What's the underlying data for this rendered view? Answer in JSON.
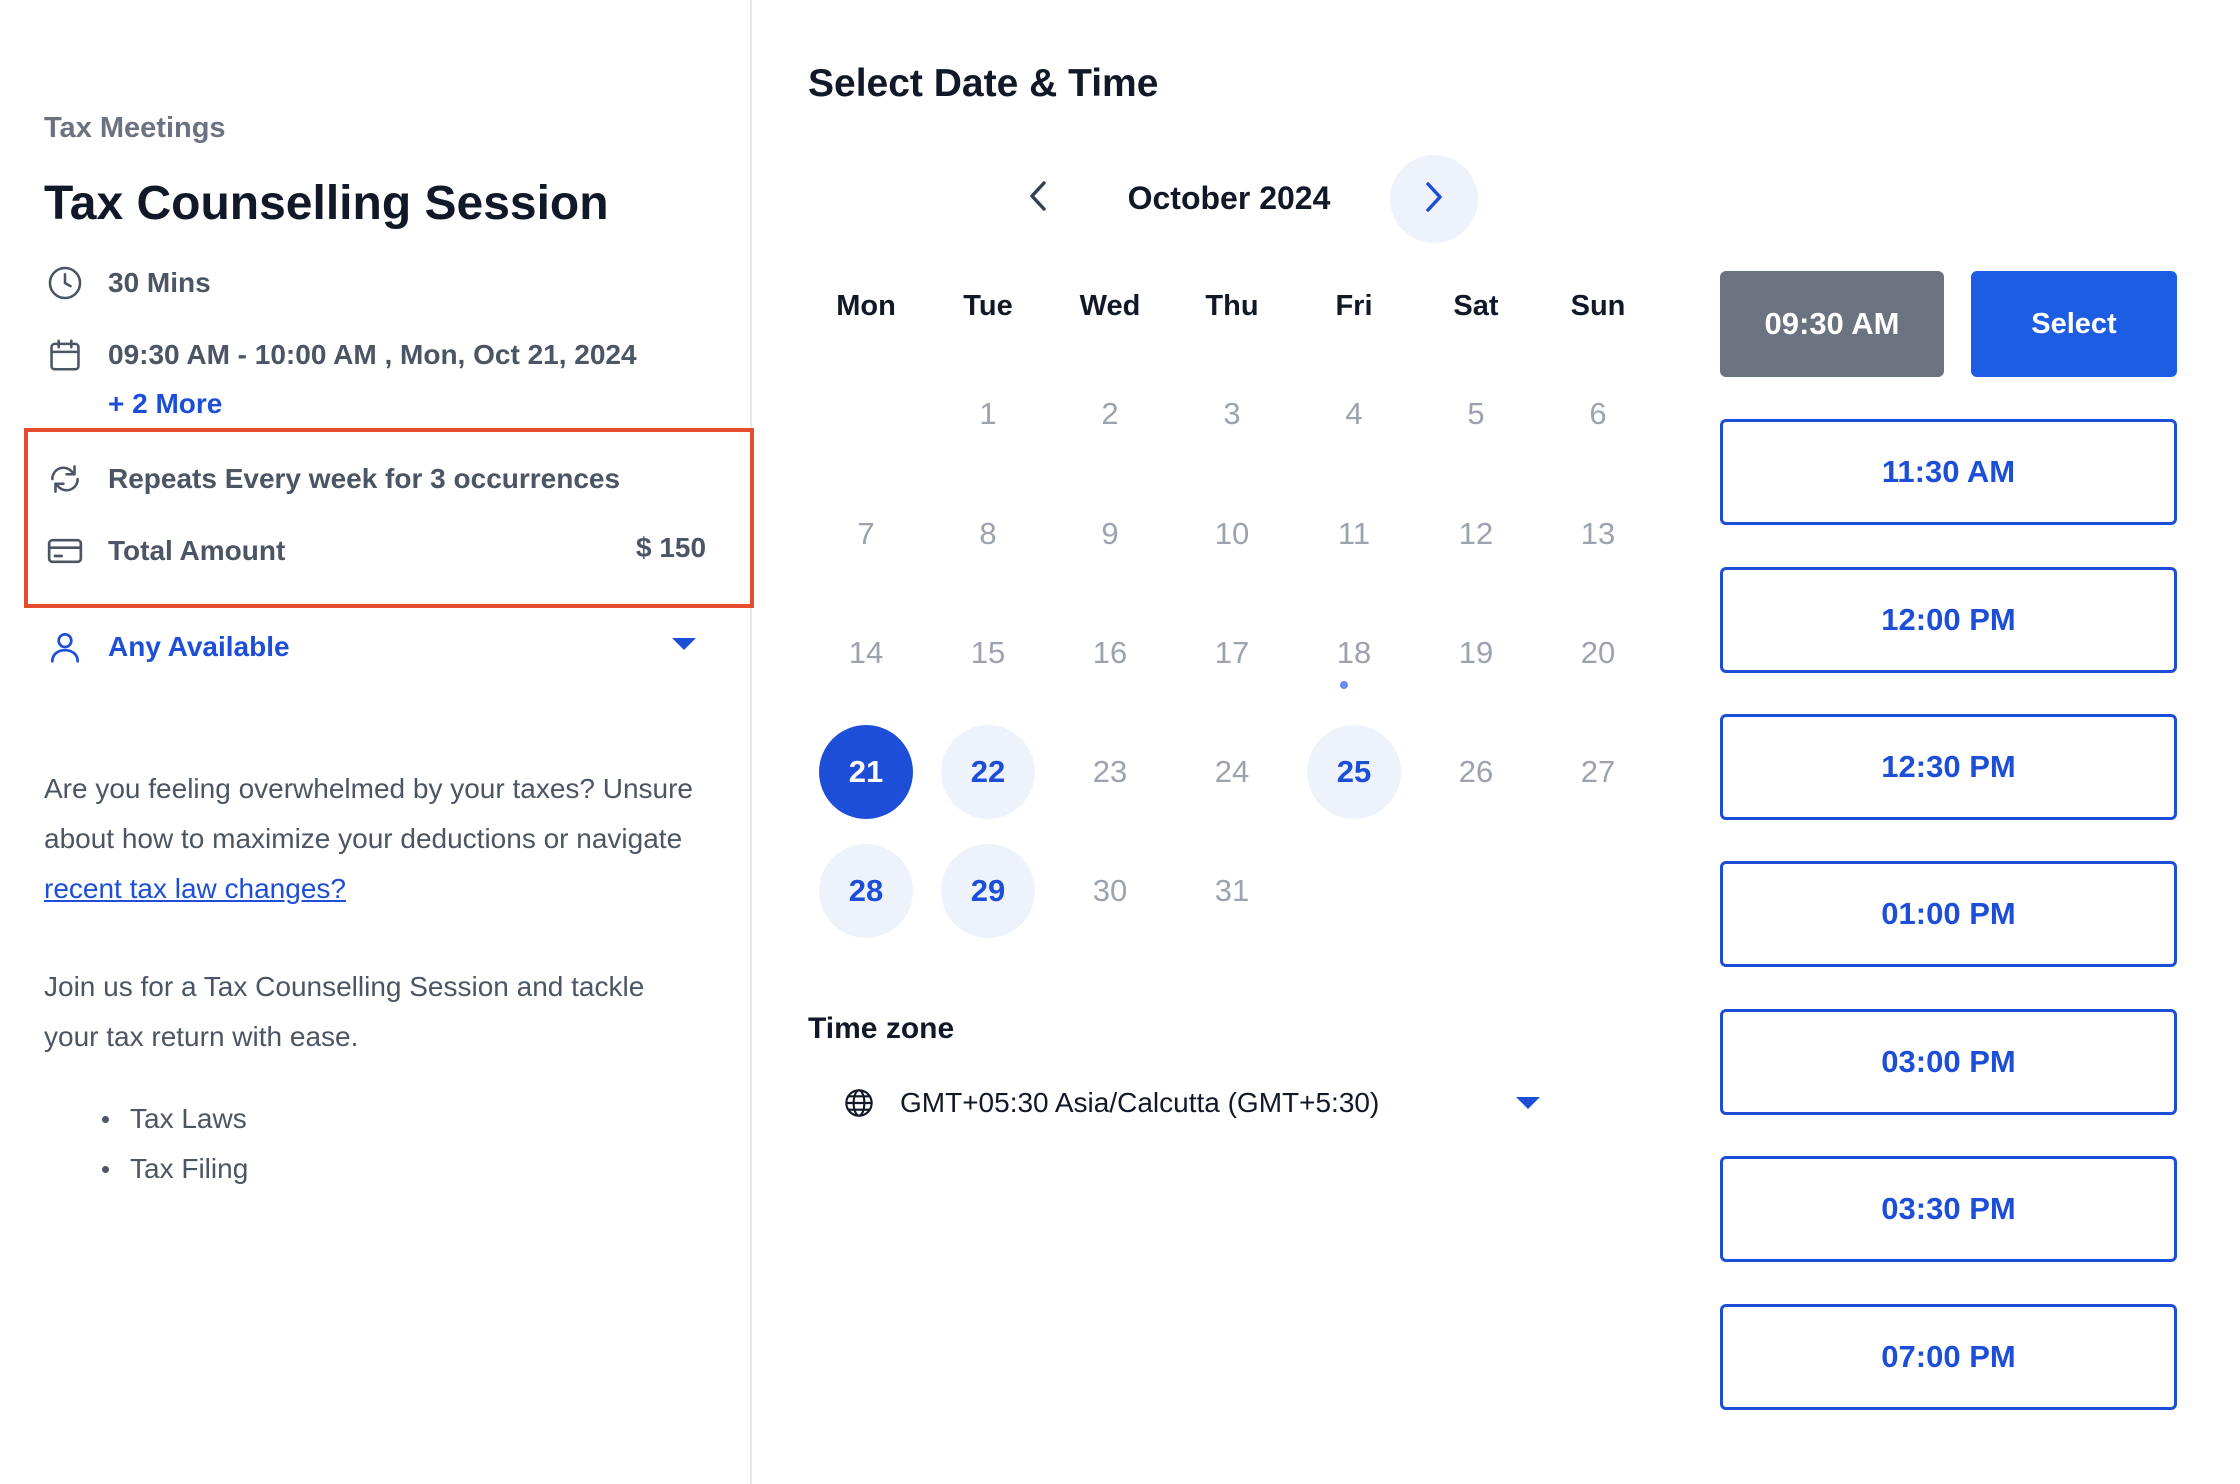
{
  "event": {
    "category": "Tax Meetings",
    "title": "Tax Counselling Session",
    "duration": "30 Mins",
    "datetime": "09:30 AM - 10:00 AM , Mon, Oct 21, 2024",
    "more_link": "+ 2 More",
    "repeat": "Repeats Every week for 3 occurrences",
    "total_label": "Total Amount",
    "total_value": "$ 150",
    "staff": "Any Available"
  },
  "description": {
    "p1_text": "Are you feeling overwhelmed by your taxes? Unsure about how to maximize your deductions or navigate ",
    "p1_link": "recent tax law changes?",
    "p2": "Join us for a Tax Counselling Session and tackle your tax return with ease.",
    "bullets": [
      "Tax Laws",
      "Tax Filing"
    ]
  },
  "calendar": {
    "heading": "Select Date & Time",
    "month_label": "October 2024",
    "weekdays": [
      "Mon",
      "Tue",
      "Wed",
      "Thu",
      "Fri",
      "Sat",
      "Sun"
    ],
    "first_day_offset": 1,
    "days_in_month": 31,
    "selected_day": 21,
    "available_days": [
      22,
      25,
      28,
      29
    ],
    "today": 18
  },
  "timezone": {
    "label": "Time zone",
    "value": "GMT+05:30 Asia/Calcutta (GMT+5:30)"
  },
  "slots": {
    "selected": "09:30 AM",
    "select_button": "Select",
    "times": [
      "11:30 AM",
      "12:00 PM",
      "12:30 PM",
      "01:00 PM",
      "03:00 PM",
      "03:30 PM",
      "07:00 PM"
    ]
  },
  "colors": {
    "primary": "#1d4ed8",
    "highlight_border": "#e54d2e",
    "selected_slot": "#6b7280",
    "available_day_bg": "#eef2fb"
  },
  "icons": {
    "duration": "clock-icon",
    "datetime": "calendar-icon",
    "repeat": "repeat-icon",
    "amount": "credit-card-icon",
    "staff": "user-icon",
    "timezone": "globe-icon"
  }
}
